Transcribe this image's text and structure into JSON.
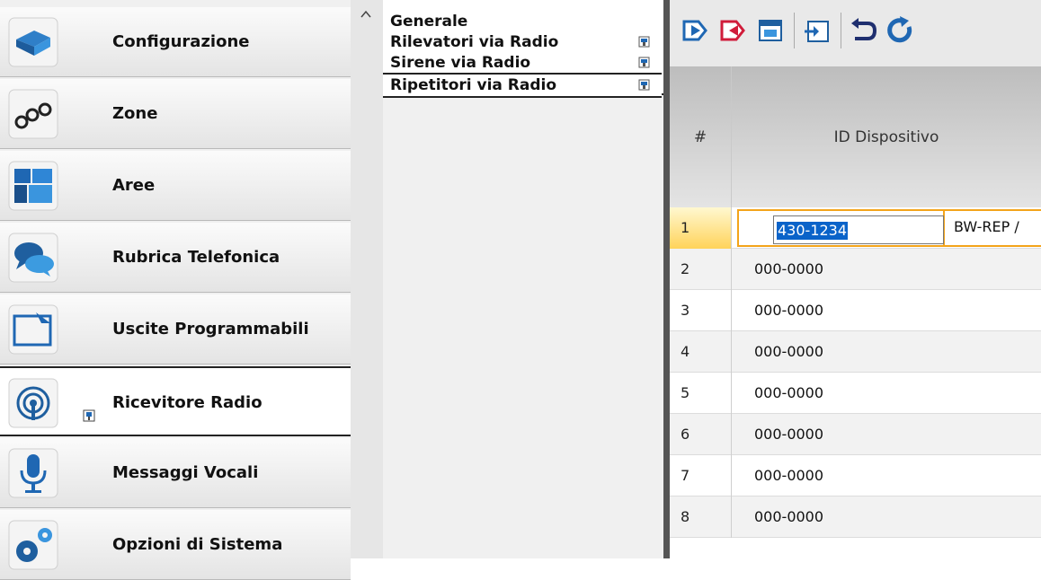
{
  "nav": {
    "items": [
      {
        "label": "Configurazione",
        "icon": "configuration-icon"
      },
      {
        "label": "Zone",
        "icon": "zones-icon"
      },
      {
        "label": "Aree",
        "icon": "areas-icon"
      },
      {
        "label": "Rubrica Telefonica",
        "icon": "phonebook-icon"
      },
      {
        "label": "Uscite Programmabili",
        "icon": "programmable-outputs-icon"
      },
      {
        "label": "Ricevitore Radio",
        "icon": "radio-receiver-icon",
        "active": true
      },
      {
        "label": "Messaggi Vocali",
        "icon": "microphone-icon"
      },
      {
        "label": "Opzioni di Sistema",
        "icon": "system-options-icon"
      }
    ]
  },
  "submenu": {
    "items": [
      {
        "label": "Generale"
      },
      {
        "label": "Rilevatori via Radio"
      },
      {
        "label": "Sirene via Radio"
      },
      {
        "label": "Ripetitori via Radio",
        "selected": true
      }
    ]
  },
  "toolbar": {
    "buttons": [
      "download-icon",
      "upload-icon",
      "save-panel-icon",
      "import-icon",
      "undo-icon",
      "refresh-icon"
    ]
  },
  "grid": {
    "headers": {
      "number": "#",
      "device_id": "ID Dispositivo"
    },
    "rows": [
      {
        "num": "1",
        "id": "430-1234",
        "next": "BW-REP /"
      },
      {
        "num": "2",
        "id": "000-0000"
      },
      {
        "num": "3",
        "id": "000-0000"
      },
      {
        "num": "4",
        "id": "000-0000"
      },
      {
        "num": "5",
        "id": "000-0000"
      },
      {
        "num": "6",
        "id": "000-0000"
      },
      {
        "num": "7",
        "id": "000-0000"
      },
      {
        "num": "8",
        "id": "000-0000"
      }
    ]
  },
  "colors": {
    "accent": "#f3a41a",
    "selection": "#0a63c9"
  }
}
